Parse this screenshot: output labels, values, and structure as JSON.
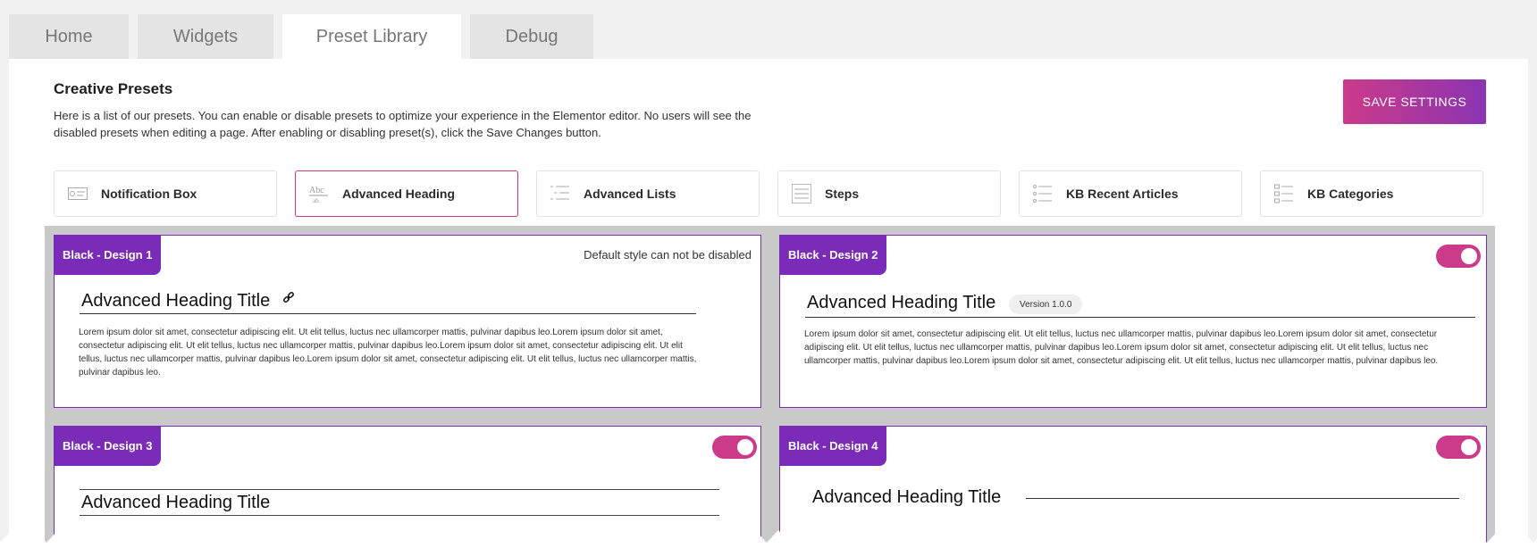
{
  "tabs": [
    {
      "label": "Home"
    },
    {
      "label": "Widgets"
    },
    {
      "label": "Preset Library"
    },
    {
      "label": "Debug"
    }
  ],
  "header": {
    "title": "Creative Presets",
    "description": "Here is a list of our presets. You can enable or disable presets to optimize your experience in the Elementor editor. No users will see the disabled presets when editing a page. After enabling or disabling preset(s), click the Save Changes button.",
    "save_label": "SAVE SETTINGS"
  },
  "presets": [
    {
      "label": "Notification Box",
      "icon": "notification-box-icon"
    },
    {
      "label": "Advanced Heading",
      "icon": "advanced-heading-icon"
    },
    {
      "label": "Advanced Lists",
      "icon": "list-icon"
    },
    {
      "label": "Steps",
      "icon": "steps-icon"
    },
    {
      "label": "KB Recent Articles",
      "icon": "recent-articles-icon"
    },
    {
      "label": "KB Categories",
      "icon": "categories-icon"
    }
  ],
  "cards": [
    {
      "badge": "Black - Design 1",
      "note": "Default style can not be disabled",
      "title": "Advanced Heading Title",
      "lorem": "Lorem ipsum dolor sit amet, consectetur adipiscing elit. Ut elit tellus, luctus nec ullamcorper mattis, pulvinar dapibus leo.Lorem ipsum dolor sit amet, consectetur adipiscing elit. Ut elit tellus, luctus nec ullamcorper mattis, pulvinar dapibus leo.Lorem ipsum dolor sit amet, consectetur adipiscing elit. Ut elit tellus, luctus nec ullamcorper mattis, pulvinar dapibus leo.Lorem ipsum dolor sit amet, consectetur adipiscing elit. Ut elit tellus, luctus nec ullamcorper mattis, pulvinar dapibus leo."
    },
    {
      "badge": "Black - Design 2",
      "title": "Advanced Heading Title",
      "version": "Version 1.0.0",
      "lorem": "Lorem ipsum dolor sit amet, consectetur adipiscing elit. Ut elit tellus, luctus nec ullamcorper mattis, pulvinar dapibus leo.Lorem ipsum dolor sit amet, consectetur adipiscing elit. Ut elit tellus, luctus nec ullamcorper mattis, pulvinar dapibus leo.Lorem ipsum dolor sit amet, consectetur adipiscing elit. Ut elit tellus, luctus nec ullamcorper mattis, pulvinar dapibus leo.Lorem ipsum dolor sit amet, consectetur adipiscing elit. Ut elit tellus, luctus nec ullamcorper mattis, pulvinar dapibus leo."
    },
    {
      "badge": "Black - Design 3",
      "title": "Advanced Heading Title"
    },
    {
      "badge": "Black - Design 4",
      "title": "Advanced Heading Title"
    }
  ],
  "colors": {
    "accent": "#7a2cb8",
    "toggle": "#cc3a8a",
    "button_start": "#cc3a8a",
    "button_end": "#8a34b2"
  }
}
